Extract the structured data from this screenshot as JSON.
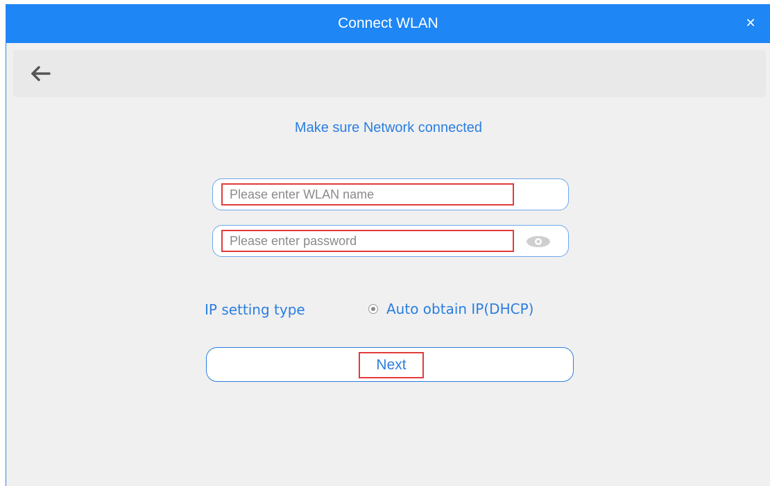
{
  "window": {
    "title": "Connect WLAN",
    "close_glyph": "✕",
    "accent_color": "#1e86f5"
  },
  "toolbar": {
    "back_icon": "arrow-left-icon"
  },
  "form": {
    "heading": "Make sure Network connected",
    "wlan_name": {
      "value": "",
      "placeholder": "Please enter WLAN name"
    },
    "password": {
      "value": "",
      "placeholder": "Please enter password",
      "toggle_icon": "eye-icon"
    },
    "ip_setting": {
      "label": "IP setting type",
      "option": "Auto obtain IP(DHCP)",
      "selected": true
    },
    "next_label": "Next"
  },
  "highlight_color": "#e23a3a"
}
